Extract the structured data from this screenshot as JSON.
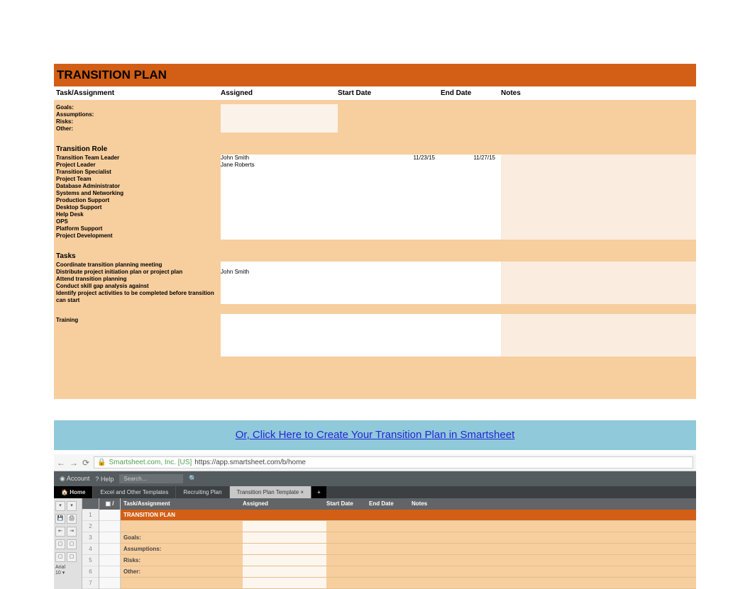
{
  "plan": {
    "title": "TRANSITION PLAN",
    "headers": {
      "task": "Task/Assignment",
      "assigned": "Assigned",
      "start": "Start Date",
      "end": "End Date",
      "notes": "Notes"
    },
    "meta_rows": [
      "Goals:",
      "Assumptions:",
      "Risks:",
      "Other:"
    ],
    "role_section": "Transition Role",
    "roles": [
      {
        "task": "Transition Team Leader",
        "assigned": "John Smith",
        "start": "11/23/15",
        "end": "11/27/15"
      },
      {
        "task": "Project Leader",
        "assigned": "Jane Roberts",
        "start": "",
        "end": ""
      },
      {
        "task": "Transition Specialist",
        "assigned": "",
        "start": "",
        "end": ""
      },
      {
        "task": "Project Team",
        "assigned": "",
        "start": "",
        "end": ""
      },
      {
        "task": "Database Administrator",
        "assigned": "",
        "start": "",
        "end": ""
      },
      {
        "task": "Systems and Networking",
        "assigned": "",
        "start": "",
        "end": ""
      },
      {
        "task": "Production Support",
        "assigned": "",
        "start": "",
        "end": ""
      },
      {
        "task": "Desktop Support",
        "assigned": "",
        "start": "",
        "end": ""
      },
      {
        "task": "Help Desk",
        "assigned": "",
        "start": "",
        "end": ""
      },
      {
        "task": "OPS",
        "assigned": "",
        "start": "",
        "end": ""
      },
      {
        "task": "Platform Support",
        "assigned": "",
        "start": "",
        "end": ""
      },
      {
        "task": "Project Development",
        "assigned": "",
        "start": "",
        "end": ""
      }
    ],
    "tasks_section": "Tasks",
    "tasks": [
      {
        "task": "Coordinate transition planning meeting",
        "assigned": "",
        "start": "",
        "end": ""
      },
      {
        "task": "Distribute project initiation plan or project plan",
        "assigned": "John Smith",
        "start": "",
        "end": ""
      },
      {
        "task": "Attend transition planning",
        "assigned": "",
        "start": "",
        "end": ""
      },
      {
        "task": "Conduct skill gap analysis against",
        "assigned": "",
        "start": "",
        "end": ""
      },
      {
        "task": "Identify project activities to be completed before transition can start",
        "assigned": "",
        "start": "",
        "end": ""
      }
    ],
    "training_section": "Training"
  },
  "cta": {
    "text": "Or, Click Here to Create Your Transition Plan in Smartsheet"
  },
  "browser": {
    "cert": "Smartsheet.com, Inc. [US]",
    "url": "https://app.smartsheet.com/b/home",
    "app": {
      "account": "Account",
      "help": "? Help",
      "search_placeholder": "Search..."
    },
    "tabs": {
      "home": "Home",
      "t1": "Excel and Other Templates",
      "t2": "Recruiting Plan",
      "t3": "Transition Plan Template"
    },
    "toolbar": {
      "font": "Arial",
      "size": "10"
    },
    "grid": {
      "headers": {
        "task": "Task/Assignment",
        "assigned": "Assigned",
        "start": "Start Date",
        "end": "End Date",
        "notes": "Notes"
      },
      "title": "TRANSITION PLAN",
      "rows": [
        "Goals:",
        "Assumptions:",
        "Risks:",
        "Other:"
      ]
    }
  }
}
